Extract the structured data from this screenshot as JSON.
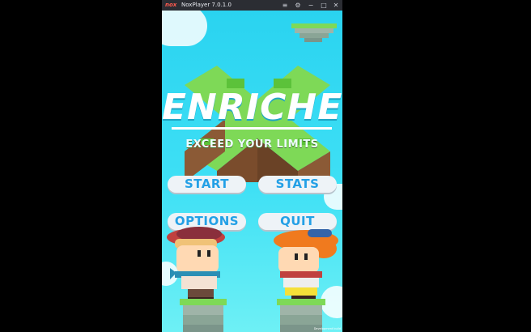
{
  "window": {
    "app_logo": "nox",
    "title": "NoxPlayer 7.0.1.0",
    "controls": [
      "menu-icon",
      "settings-icon",
      "minimize-icon",
      "maximize-icon",
      "close-icon"
    ]
  },
  "game": {
    "title": "ENRICHE",
    "tagline": "EXCEED YOUR LIMITS",
    "buttons": {
      "start": "START",
      "stats": "STATS",
      "options": "OPTIONS",
      "quit": "QUIT"
    },
    "credit": "Development build"
  },
  "colors": {
    "sky": "#3fe0f5",
    "button_text": "#23a0e6",
    "button_bg": "#eef3f7",
    "grass": "#7ed957",
    "dirt": "#8b5a36"
  }
}
